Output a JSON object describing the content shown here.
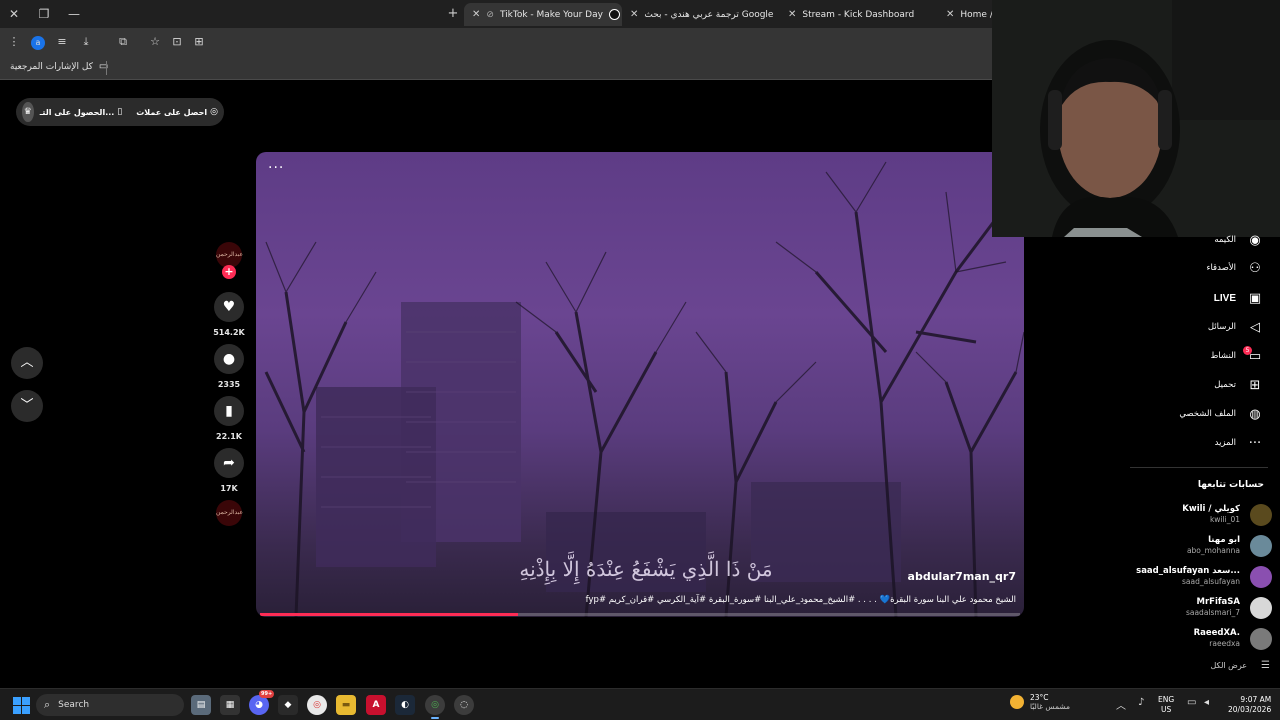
{
  "browser": {
    "tabs": [
      {
        "label": "TikTok - Make Your Day",
        "active": true,
        "favicon_color": "#111111"
      },
      {
        "label": "ترجمة عربي هندي - بحث Google",
        "active": false,
        "favicon_color": "#4285f4"
      },
      {
        "label": "Stream - Kick Dashboard",
        "active": false,
        "favicon_color": "#53fc18"
      },
      {
        "label": "Home / X",
        "active": false,
        "favicon_color": "#e6e6e6"
      }
    ],
    "profile_initial": "a",
    "bookmarks_all": "كل الإشارات المرجعية"
  },
  "page": {
    "top_buttons": {
      "coins": "احصل على عملات",
      "app": "الحصول على التـ..."
    },
    "video": {
      "caption_arabic": "مَنْ ذَا الَّذِي يَشْفَعُ عِنْدَهُ إِلَّا بِإِذْنِهِ",
      "author": "abdular7man_qr7",
      "description": "الشيخ محمود علي البنا سورة البقرة💙 . . . . #الشيخ_محمود_علي_البنا #سورة_البقرة #آية_الكرسي #قران_كريم #fyp",
      "progress": 0.34
    },
    "actions": {
      "creator_avatar_text": "عبدالرحمن",
      "likes": "514.2K",
      "comments": "2335",
      "saves": "22.1K",
      "shares": "17K",
      "sound_avatar_text": "عبدالرحمن"
    }
  },
  "sidebar": {
    "nav": [
      {
        "label": "الكيمه",
        "icon": "explore-icon"
      },
      {
        "label": "الأصدقاء",
        "icon": "friends-icon"
      },
      {
        "label": "LIVE",
        "icon": "live-icon"
      },
      {
        "label": "الرسائل",
        "icon": "messages-icon"
      },
      {
        "label": "النشاط",
        "icon": "activity-icon"
      },
      {
        "label": "تحميل",
        "icon": "upload-icon"
      },
      {
        "label": "الملف الشخصي",
        "icon": "profile-icon"
      },
      {
        "label": "المزيد",
        "icon": "more-icon"
      }
    ],
    "activity_badge": "5",
    "following_title": "حسابات تتابعها",
    "accounts": [
      {
        "name": "Kwili / كويلي",
        "handle": "kwili_01",
        "color": "#5a4a1e"
      },
      {
        "name": "ابو مهنا",
        "handle": "abo_mohanna",
        "color": "#6a8a9a"
      },
      {
        "name": "saad_alsufayan سعد...",
        "handle": "saad_alsufayan",
        "color": "#8a4fb0"
      },
      {
        "name": "MrFifaSA",
        "handle": "saadalsmari_7",
        "color": "#d8d8d8"
      },
      {
        "name": "RaeedXA.",
        "handle": "raeedxa",
        "color": "#7a7a7a"
      }
    ],
    "see_all": "عرض الكل"
  },
  "taskbar": {
    "search": "Search",
    "discord_badge": "99+",
    "weather_temp": "23°C",
    "weather_cond": "مشمس غالبًا",
    "lang_line1": "ENG",
    "lang_line2": "US",
    "time": "9:07 AM",
    "date": "20/03/2026"
  }
}
